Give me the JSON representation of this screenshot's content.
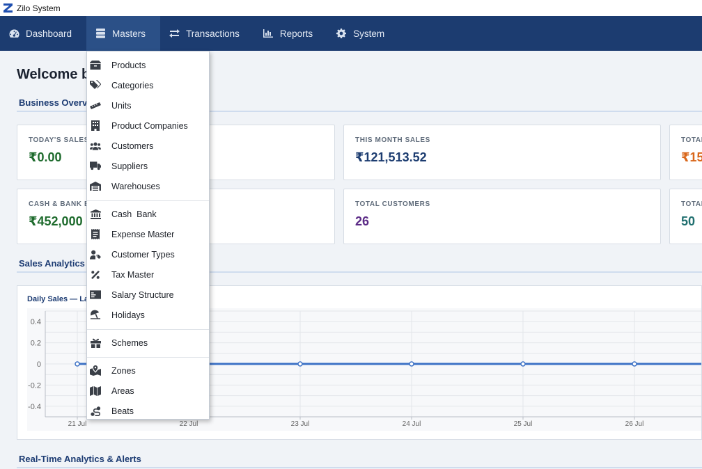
{
  "window": {
    "title": "Zilo System"
  },
  "nav": {
    "items": [
      {
        "label": "Dashboard",
        "icon": "dashboard-gauge-icon"
      },
      {
        "label": "Masters",
        "icon": "database-icon",
        "active": true
      },
      {
        "label": "Transactions",
        "icon": "exchange-arrows-icon"
      },
      {
        "label": "Reports",
        "icon": "bar-chart-icon"
      },
      {
        "label": "System",
        "icon": "gear-icon"
      }
    ]
  },
  "main": {
    "welcome": "Welcome b",
    "business_overview": "Business Overvi",
    "sales_analytics": "Sales Analytics",
    "realtime": "Real-Time Analytics & Alerts"
  },
  "cards": {
    "today_sales": {
      "label": "TODAY'S SALES",
      "value": "₹0.00",
      "color": "#1e6b2d"
    },
    "month_sales": {
      "label": "THIS MONTH SALES",
      "value": "₹121,513.52",
      "color": "#1c3c70"
    },
    "total_right_1": {
      "label": "TOTAL",
      "value": "₹15",
      "color": "#d9661a"
    },
    "cash_bank": {
      "label": "CASH & BANK B",
      "value": "₹452,000",
      "color": "#1e6b2d"
    },
    "total_customers": {
      "label": "TOTAL CUSTOMERS",
      "value": "26",
      "color": "#5b2a86"
    },
    "total_right_2": {
      "label": "TOTAL",
      "value": "50",
      "color": "#1e6e6e"
    }
  },
  "chart_data": {
    "type": "line",
    "title": "Daily Sales — La",
    "categories": [
      "21 Jul",
      "22 Jul",
      "23 Jul",
      "24 Jul",
      "25 Jul",
      "26 Jul"
    ],
    "series": [
      {
        "values": [
          0,
          0,
          0,
          0,
          0,
          0
        ],
        "color": "#3d72c6"
      }
    ],
    "yticks": [
      0.4,
      0.2,
      0,
      -0.2,
      -0.4
    ],
    "ylim": [
      -0.5,
      0.5
    ],
    "grid": true
  },
  "masters_menu": {
    "groups": [
      [
        {
          "label": "Products",
          "icon": "box-icon"
        },
        {
          "label": "Categories",
          "icon": "tags-icon"
        },
        {
          "label": "Units",
          "icon": "ruler-icon"
        },
        {
          "label": "Product Companies",
          "icon": "building-icon"
        },
        {
          "label": "Customers",
          "icon": "users-icon"
        },
        {
          "label": "Suppliers",
          "icon": "truck-icon"
        },
        {
          "label": "Warehouses",
          "icon": "warehouse-icon"
        }
      ],
      [
        {
          "label": "Cash  Bank",
          "icon": "bank-icon"
        },
        {
          "label": "Expense Master",
          "icon": "receipt-icon"
        },
        {
          "label": "Customer Types",
          "icon": "user-tag-icon"
        },
        {
          "label": "Tax Master",
          "icon": "percent-icon"
        },
        {
          "label": "Salary Structure",
          "icon": "money-card-icon"
        },
        {
          "label": "Holidays",
          "icon": "umbrella-beach-icon"
        }
      ],
      [
        {
          "label": "Schemes",
          "icon": "gift-icon"
        }
      ],
      [
        {
          "label": "Zones",
          "icon": "map-marked-icon"
        },
        {
          "label": "Areas",
          "icon": "map-icon"
        },
        {
          "label": "Beats",
          "icon": "route-icon"
        }
      ]
    ]
  }
}
